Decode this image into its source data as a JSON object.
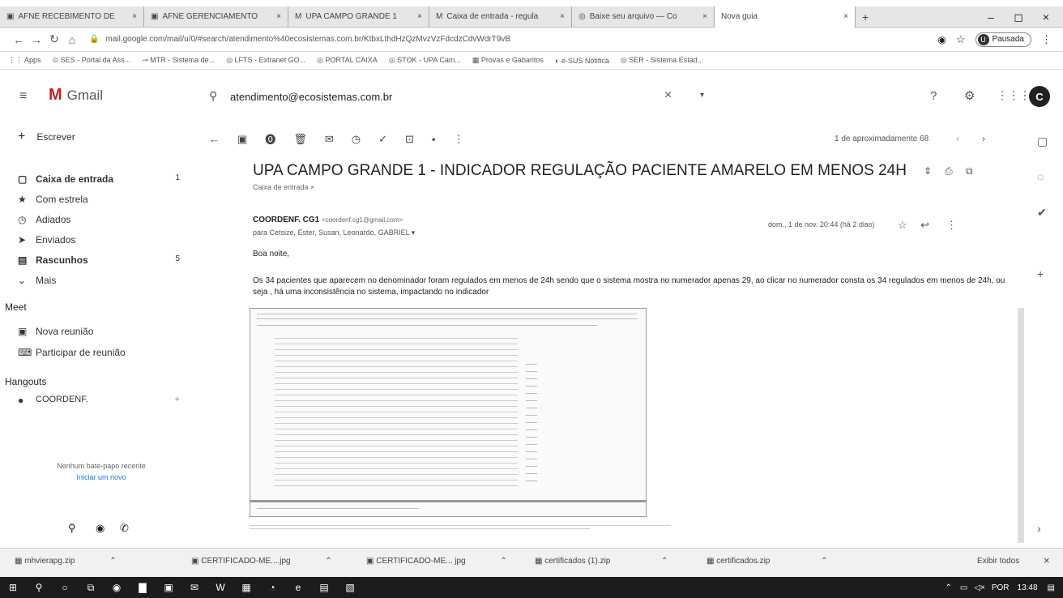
{
  "tabs": [
    {
      "label": "AFNE RECEBIMENTO DE"
    },
    {
      "label": "AFNE GERENCIAMENTO"
    },
    {
      "label": "UPA CAMPO GRANDE 1"
    },
    {
      "label": "Caixa de entrada - regula"
    },
    {
      "label": "Baixe seu arquivo — Co"
    },
    {
      "label": "Nova guia"
    }
  ],
  "browser": {
    "url": "mail.google.com/mail/u/0/#search/atendimento%40ecosistemas.com.br/KtbxLthdHzQzMvzVzFdcdzCdvWdrT9vB",
    "profile_label": "Pausada",
    "bookmarks": [
      "Apps",
      "SES - Portal da Ass...",
      "MTR - Sistema de...",
      "LFTS - Extranet GO...",
      "PORTAL CAIXA",
      "STOK - UPA Cam...",
      "Provas e Gabaritos",
      "e-SUS Notifica",
      "SER - Sistema Estad..."
    ]
  },
  "gmail": {
    "logo_text": "Gmail",
    "search_value": "atendimento@ecosistemas.com.br",
    "avatar_letter": "C",
    "compose_label": "Escrever",
    "nav": [
      {
        "label": "Caixa de entrada",
        "count": "1",
        "icon": "inbox-icon"
      },
      {
        "label": "Com estrela",
        "count": "",
        "icon": "star-icon"
      },
      {
        "label": "Adiados",
        "count": "",
        "icon": "clock-icon"
      },
      {
        "label": "Enviados",
        "count": "",
        "icon": "send-icon"
      },
      {
        "label": "Rascunhos",
        "count": "5",
        "icon": "draft-icon"
      },
      {
        "label": "Mais",
        "count": "",
        "icon": "chevron-down-icon"
      }
    ],
    "meet_title": "Meet",
    "meet_items": [
      {
        "label": "Nova reunião"
      },
      {
        "label": "Participar de reunião"
      }
    ],
    "hangouts_title": "Hangouts",
    "hangouts_contact": "COORDENF.",
    "no_chat": "Nenhum bate-papo recente",
    "start_new": "Iniciar um novo"
  },
  "email": {
    "pagination": "1 de aproximadamente 68",
    "subject": "UPA CAMPO GRANDE 1 - INDICADOR REGULAÇÃO PACIENTE AMARELO EM MENOS 24H",
    "label_tag": "Caixa de entrada ×",
    "sender": "COORDENF. CG1",
    "sender_email": "<coordenf.cg1@gmail.com>",
    "recipients": "para Cetsize, Ester, Susan, Leonardo, GABRIEL ▾",
    "date": "dom., 1 de nov. 20:44 (há 2 dias)",
    "greeting": "Boa noite,",
    "body": "Os 34 pacientes que aparecem no denominador foram regulados em menos de 24h sendo que o sistema mostra no numerador apenas 29, ao clicar no numerador consta os 34 regulados em menos de 24h, ou seja , há uma inconsistência no sistema, impactando no indicador"
  },
  "downloads": [
    {
      "label": "mhvierapg.zip"
    },
    {
      "label": "CERTIFICADO-ME....jpg"
    },
    {
      "label": "CERTIFICADO-ME... jpg"
    },
    {
      "label": "certificados (1).zip"
    },
    {
      "label": "certificados.zip"
    }
  ],
  "show_all": "Exibir todos",
  "taskbar": {
    "lang": "POR",
    "time": "13:48"
  }
}
